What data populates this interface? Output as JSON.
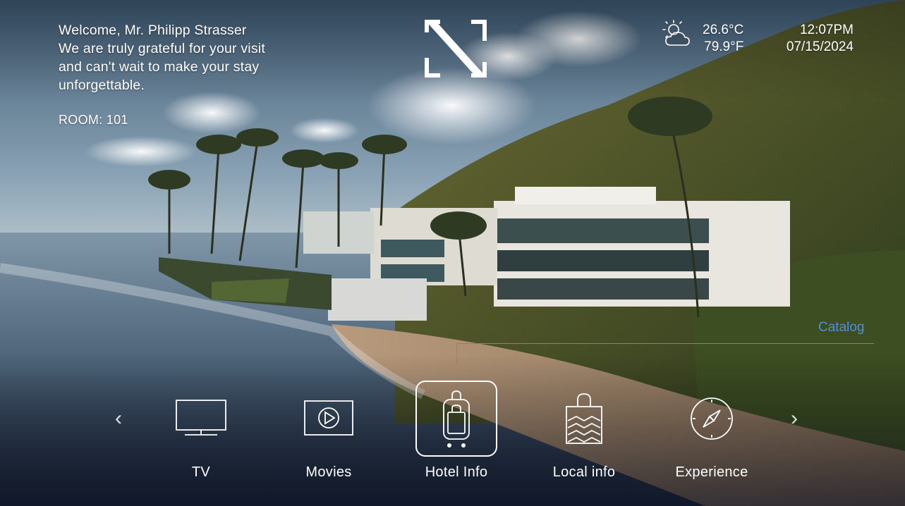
{
  "welcome": {
    "line1": "Welcome, Mr. Philipp Strasser",
    "line2": "We are truly grateful for your visit",
    "line3": "and can't wait to make your stay",
    "line4": "unforgettable."
  },
  "room": "ROOM: 101",
  "weather": {
    "icon": "partly-cloudy-icon",
    "celsius": "26.6°C",
    "fahrenheit": "79.9°F"
  },
  "clock": {
    "time": "12:07PM",
    "date": "07/15/2024"
  },
  "catalog": {
    "label": "Catalog"
  },
  "nav": {
    "items": [
      {
        "label": "TV",
        "icon": "tv-icon"
      },
      {
        "label": "Movies",
        "icon": "play-icon"
      },
      {
        "label": "Hotel Info",
        "icon": "luggage-icon",
        "selected": true
      },
      {
        "label": "Local info",
        "icon": "shopping-bag-icon"
      },
      {
        "label": "Experience",
        "icon": "compass-icon"
      }
    ],
    "prev_icon": "chevron-left-icon",
    "next_icon": "chevron-right-icon"
  },
  "colors": {
    "accent": "#4f8fd8",
    "text": "#ffffff"
  }
}
